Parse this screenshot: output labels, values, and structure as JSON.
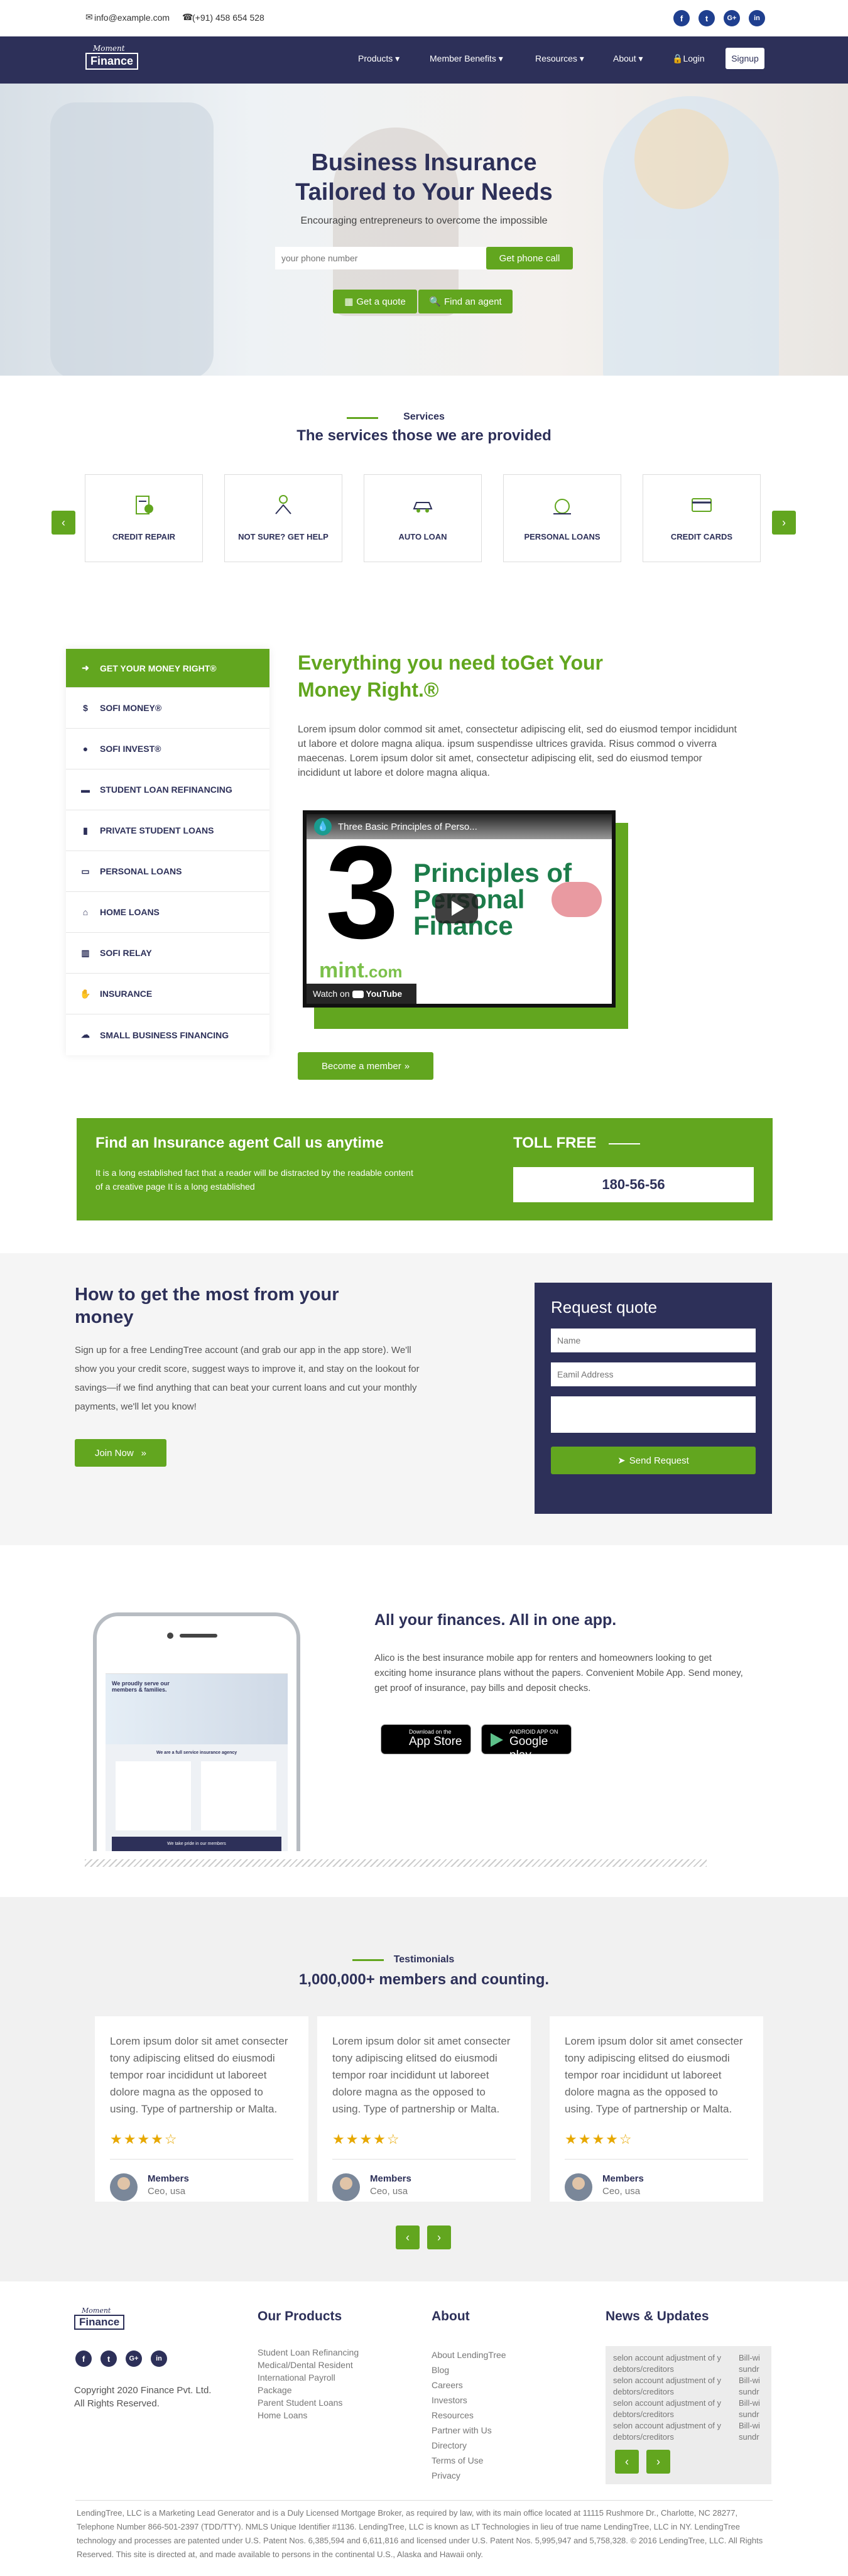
{
  "topbar": {
    "email": "info@example.com",
    "phone": "(+91) 458 654 528"
  },
  "nav": {
    "logo_top": "Moment",
    "logo": "Finance",
    "items": [
      "Products",
      "Member Benefits",
      "Resources",
      "About"
    ],
    "login": "Login",
    "signup": "Signup"
  },
  "hero": {
    "title1": "Business Insurance",
    "title2": "Tailored to Your Needs",
    "subtitle": "Encouraging entrepreneurs to overcome the impossible",
    "phone_placeholder": "your phone number",
    "call_btn": "Get phone call",
    "quote_btn": "Get a quote",
    "agent_btn": "Find an agent"
  },
  "services": {
    "eyebrow": "Services",
    "title": "The services those we are provided",
    "cards": [
      "CREDIT REPAIR",
      "NOT SURE? GET HELP",
      "AUTO LOAN",
      "PERSONAL LOANS",
      "CREDIT CARDS"
    ]
  },
  "sidebar": {
    "items": [
      "GET YOUR MONEY RIGHT®",
      "SOFI MONEY®",
      "SOFI INVEST®",
      "STUDENT LOAN REFINANCING",
      "PRIVATE STUDENT LOANS",
      "PERSONAL LOANS",
      "HOME LOANS",
      "SOFI RELAY",
      "INSURANCE",
      "SMALL BUSINESS FINANCING"
    ]
  },
  "feature": {
    "title1": "Everything you need toGet Your",
    "title2": "Money Right.®",
    "body": "Lorem ipsum dolor commod sit amet, consectetur adipiscing elit, sed do eiusmod tempor incididunt ut labore et dolore magna aliqua. ipsum suspendisse ultrices gravida. Risus commod o viverra maecenas. Lorem ipsum dolor sit amet, consectetur adipiscing elit, sed do eiusmod tempor incididunt ut labore et dolore magna aliqua.",
    "video_title": "Three Basic Principles of Perso...",
    "video_big": "3",
    "video_line1": "Principles of",
    "video_line2": "Personal",
    "video_line3": "Finance",
    "watch_on": "Watch on",
    "youtube": "YouTube",
    "mint": "mint",
    "mint_com": ".com",
    "member_btn": "Become a member"
  },
  "cta": {
    "title": "Find an Insurance agent Call us anytime",
    "body": "It is a long established fact that a reader will be distracted by the readable content of a creative page It is a long established",
    "toll": "TOLL FREE",
    "number": "180-56-56"
  },
  "howto": {
    "title1": "How to get the most from your",
    "title2": "money",
    "body": "Sign up for a free LendingTree account (and grab our app in the app store). We'll show you your credit score, suggest ways to improve it, and stay on the lookout for savings—if we find anything that can beat your current loans and cut your monthly payments, we'll let you know!",
    "join": "Join Now"
  },
  "quote": {
    "title": "Request quote",
    "name": "Name",
    "email": "Eamil Address",
    "send": "Send Request"
  },
  "app": {
    "title": "All your finances. All in one app.",
    "body": "Alico is the best insurance mobile app for renters and homeowners looking to get exciting home insurance plans without the papers. Convenient Mobile App. Send money, get proof of insurance, pay bills and deposit checks.",
    "appstore_small": "Download on the",
    "appstore": "App Store",
    "gplay_small": "ANDROID APP ON",
    "gplay": "Google play",
    "phone_headline": "We proudly serve our members & families.",
    "phone_sub": "We are a full service insurance agency",
    "phone_banner": "We take pride in our members"
  },
  "testimonials": {
    "eyebrow": "Testimonials",
    "title": "1,000,000+ members and counting.",
    "items": [
      {
        "text": "Lorem ipsum dolor sit amet consecter tony adipiscing elitsed do eiusmodi tempor roar incididunt ut laboreet dolore magna as the opposed to using. Type of partnership or Malta.",
        "stars": 4,
        "name": "Members",
        "role": "Ceo, usa"
      },
      {
        "text": "Lorem ipsum dolor sit amet consecter tony adipiscing elitsed do eiusmodi tempor roar incididunt ut laboreet dolore magna as the opposed to using. Type of partnership or Malta.",
        "stars": 4,
        "name": "Members",
        "role": "Ceo, usa"
      },
      {
        "text": "Lorem ipsum dolor sit amet consecter tony adipiscing elitsed do eiusmodi tempor roar incididunt ut laboreet dolore magna as the opposed to using. Type of partnership or Malta.",
        "stars": 4,
        "name": "Members",
        "role": "Ceo, usa"
      }
    ]
  },
  "footer": {
    "copyright1": "Copyright 2020 Finance Pvt. Ltd.",
    "copyright2": "All Rights Reserved.",
    "products_title": "Our Products",
    "products": [
      "Student Loan Refinancing",
      "Medical/Dental Resident",
      "International Payroll",
      "Package",
      "Parent Student Loans",
      "Home Loans"
    ],
    "about_title": "About",
    "about": [
      "About LendingTree",
      "Blog",
      "Careers",
      "Investors",
      "Resources",
      "Partner with Us",
      "Directory",
      "Terms of Use",
      "Privacy"
    ],
    "news_title": "News & Updates",
    "news": [
      "selon account adjustment of y debtors/creditors",
      "selon account adjustment of y debtors/creditors",
      "selon account adjustment of y debtors/creditors",
      "selon account adjustment of y debtors/creditors"
    ],
    "news_side": [
      "Bill-wi sundr",
      "Bill-wi sundr",
      "Bill-wi sundr",
      "Bill-wi sundr"
    ],
    "legal": "LendingTree, LLC is a Marketing Lead Generator and is a Duly Licensed Mortgage Broker, as required by law, with its main office located at 11115 Rushmore Dr., Charlotte, NC 28277, Telephone Number 866-501-2397 (TDD/TTY). NMLS Unique Identifier #1136. LendingTree, LLC is known as LT Technologies in lieu of true name LendingTree, LLC in NY. LendingTree technology and processes are patented under U.S. Patent Nos. 6,385,594 and 6,611,816 and licensed under U.S. Patent Nos. 5,995,947 and 5,758,328. © 2016 LendingTree, LLC. All Rights Reserved. This site is directed at, and made available to persons in the continental U.S., Alaska and Hawaii only."
  },
  "colors": {
    "green": "#62a61f",
    "navy": "#2d3059",
    "social": "#1f3f8f"
  }
}
